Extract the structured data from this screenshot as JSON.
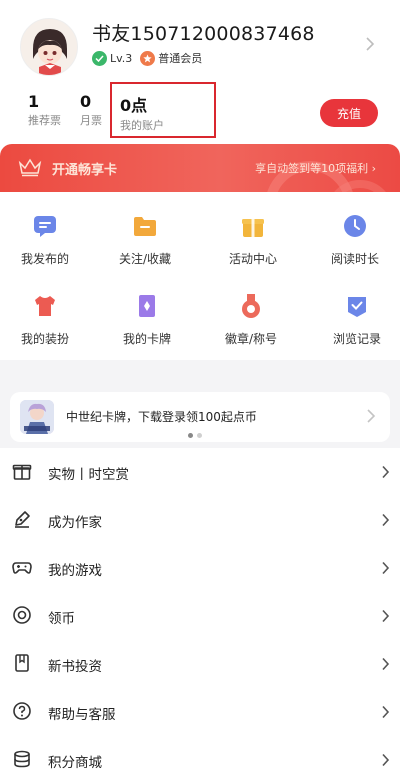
{
  "profile": {
    "username": "书友150712000837468",
    "level": "Lv.3",
    "membership": "普通会员"
  },
  "stats": [
    {
      "value": "1",
      "label": "推荐票"
    },
    {
      "value": "0",
      "label": "月票"
    },
    {
      "value": "0点",
      "label": "我的账户"
    }
  ],
  "recharge_label": "充值",
  "vip": {
    "title": "开通畅享卡",
    "benefit": "享自动签到等10项福利"
  },
  "grid": [
    {
      "label": "我发布的",
      "icon": "message-icon",
      "color": "#6b86e8"
    },
    {
      "label": "关注/收藏",
      "icon": "folder-icon",
      "color": "#f2a83b"
    },
    {
      "label": "活动中心",
      "icon": "gift-icon",
      "color": "#f2b53b"
    },
    {
      "label": "阅读时长",
      "icon": "clock-icon",
      "color": "#6b86e8"
    },
    {
      "label": "我的装扮",
      "icon": "shirt-icon",
      "color": "#ec5b52"
    },
    {
      "label": "我的卡牌",
      "icon": "card-icon",
      "color": "#9b7ae8"
    },
    {
      "label": "徽章/称号",
      "icon": "medal-icon",
      "color": "#ec6a5b"
    },
    {
      "label": "浏览记录",
      "icon": "history-icon",
      "color": "#6b86e8"
    }
  ],
  "promo": {
    "text": "中世纪卡牌，下载登录领100起点币"
  },
  "menu": [
    {
      "label": "实物丨时空赏",
      "icon": "gift-box-icon"
    },
    {
      "label": "成为作家",
      "icon": "pen-icon"
    },
    {
      "label": "我的游戏",
      "icon": "gamepad-icon"
    },
    {
      "label": "领币",
      "icon": "coin-icon"
    },
    {
      "label": "新书投资",
      "icon": "bookmark-icon"
    },
    {
      "label": "帮助与客服",
      "icon": "help-icon"
    },
    {
      "label": "积分商城",
      "icon": "shop-icon"
    }
  ]
}
